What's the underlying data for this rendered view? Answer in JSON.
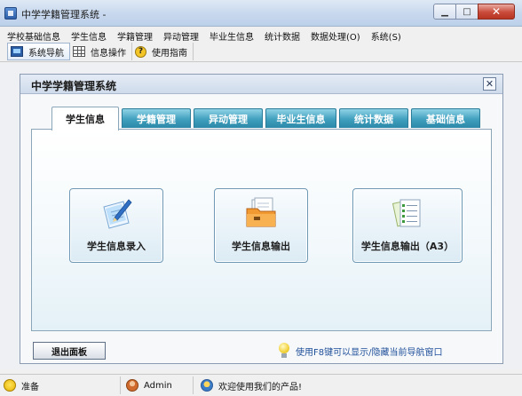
{
  "window": {
    "title": "中学学籍管理系统 -",
    "buttons": {
      "minimize": "▁",
      "maximize": "□",
      "close": "✕"
    }
  },
  "menu": {
    "items": [
      "学校基础信息",
      "学生信息",
      "学籍管理",
      "异动管理",
      "毕业生信息",
      "统计数据",
      "数据处理(O)",
      "系统(S)"
    ]
  },
  "toolbar": {
    "items": [
      {
        "label": "系统导航",
        "icon": "monitor-icon",
        "active": true
      },
      {
        "label": "信息操作",
        "icon": "grid-icon",
        "active": false
      },
      {
        "label": "使用指南",
        "icon": "help-icon",
        "active": false
      }
    ],
    "help_glyph": "?"
  },
  "panel": {
    "title": "中学学籍管理系统",
    "close": "✕",
    "tabs": [
      "学生信息",
      "学籍管理",
      "异动管理",
      "毕业生信息",
      "统计数据",
      "基础信息"
    ],
    "active_tab": 0,
    "features": [
      {
        "label": "学生信息录入",
        "icon": "pen-paper-icon"
      },
      {
        "label": "学生信息输出",
        "icon": "folder-icon"
      },
      {
        "label": "学生信息输出（A3）",
        "icon": "checklist-icon"
      }
    ],
    "exit_label": "退出面板",
    "hint": "使用F8键可以显示/隐藏当前导航窗口"
  },
  "statusbar": {
    "status": "准备",
    "user": "Admin",
    "welcome": "欢迎使用我们的产品!"
  },
  "colors": {
    "tab_blue": "#3f9fbd",
    "hint_blue": "#1e4f9a",
    "title_bar": "#c9d9ee"
  }
}
